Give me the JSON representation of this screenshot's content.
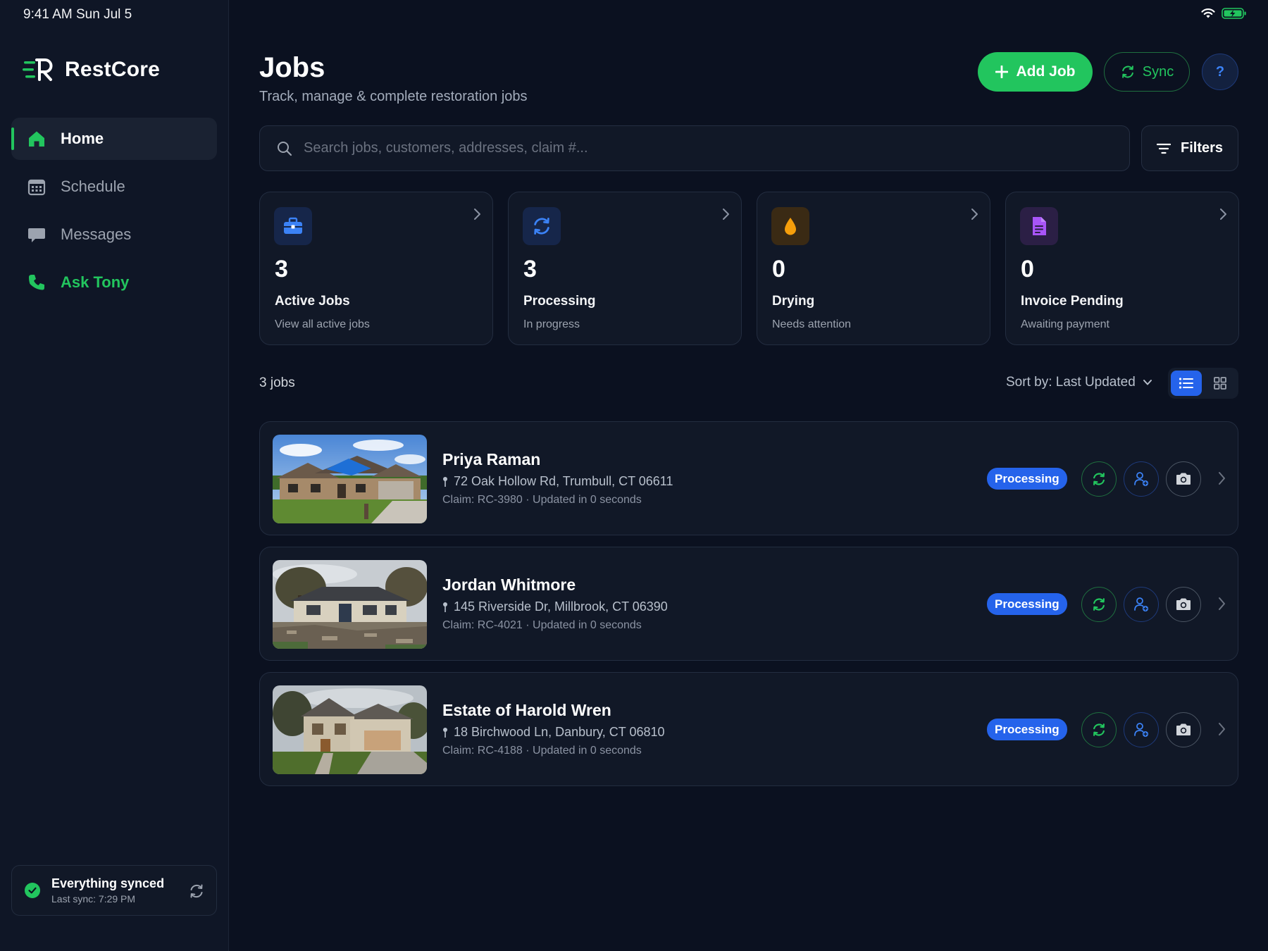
{
  "status_bar": {
    "time": "9:41 AM   Sun Jul 5"
  },
  "sidebar": {
    "brand": "RestCore",
    "items": [
      {
        "label": "Home",
        "icon": "home-icon"
      },
      {
        "label": "Schedule",
        "icon": "calendar-icon"
      },
      {
        "label": "Messages",
        "icon": "chat-icon"
      },
      {
        "label": "Ask Tony",
        "icon": "phone-icon"
      }
    ],
    "sync": {
      "title": "Everything synced",
      "subtitle": "Last sync: 7:29 PM"
    }
  },
  "header": {
    "title": "Jobs",
    "subtitle": "Track, manage & complete restoration jobs",
    "add_label": "Add Job",
    "sync_label": "Sync",
    "help_label": "?"
  },
  "search": {
    "placeholder": "Search jobs, customers, addresses, claim #...",
    "filters_label": "Filters"
  },
  "stats": [
    {
      "count": "3",
      "title": "Active Jobs",
      "subtitle": "View all active jobs",
      "icon": "briefcase-icon",
      "color": "#3b82f6"
    },
    {
      "count": "3",
      "title": "Processing",
      "subtitle": "In progress",
      "icon": "refresh-icon",
      "color": "#3b82f6"
    },
    {
      "count": "0",
      "title": "Drying",
      "subtitle": "Needs attention",
      "icon": "water-drop-icon",
      "color": "#f59e0b"
    },
    {
      "count": "0",
      "title": "Invoice Pending",
      "subtitle": "Awaiting payment",
      "icon": "document-icon",
      "color": "#a855f7"
    }
  ],
  "list": {
    "count_label": "3 jobs",
    "sort_label": "Sort by: Last Updated"
  },
  "jobs": [
    {
      "name": "Priya Raman",
      "address": "72 Oak Hollow Rd, Trumbull, CT 06611",
      "meta": "Claim: RC-3980  ·  Updated in 0 seconds",
      "status": "Processing"
    },
    {
      "name": "Jordan Whitmore",
      "address": "145 Riverside Dr, Millbrook, CT 06390",
      "meta": "Claim: RC-4021  ·  Updated in 0 seconds",
      "status": "Processing"
    },
    {
      "name": "Estate of Harold Wren",
      "address": "18 Birchwood Ln, Danbury, CT 06810",
      "meta": "Claim: RC-4188  ·  Updated in 0 seconds",
      "status": "Processing"
    }
  ],
  "colors": {
    "accent_green": "#22c55e",
    "accent_blue": "#2563eb",
    "background": "#0b1120"
  }
}
